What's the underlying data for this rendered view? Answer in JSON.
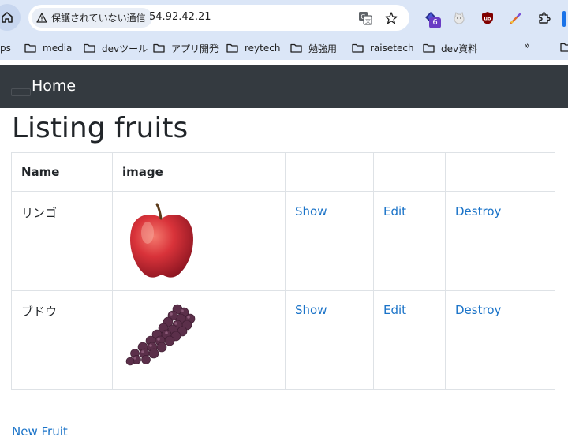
{
  "browser": {
    "security_label": "保護されていない通信",
    "url": "54.92.42.21",
    "extension_badge": "6",
    "bookmarks": [
      {
        "label": "ps"
      },
      {
        "label": "media"
      },
      {
        "label": "devツール"
      },
      {
        "label": "アプリ開発"
      },
      {
        "label": "reytech"
      },
      {
        "label": "勉強用"
      },
      {
        "label": "raisetech"
      },
      {
        "label": "dev資料"
      }
    ],
    "more_label": "»"
  },
  "navbar": {
    "brand": "Home"
  },
  "page": {
    "title": "Listing fruits",
    "headers": {
      "name": "Name",
      "image": "image"
    },
    "rows": [
      {
        "name": "リンゴ",
        "image_icon": "apple-image",
        "show": "Show",
        "edit": "Edit",
        "destroy": "Destroy"
      },
      {
        "name": "ブドウ",
        "image_icon": "grape-image",
        "show": "Show",
        "edit": "Edit",
        "destroy": "Destroy"
      }
    ],
    "new_link": "New Fruit"
  },
  "colors": {
    "navbar": "#343a40",
    "link": "#1a73c8",
    "chrome": "#dbe6f7"
  }
}
